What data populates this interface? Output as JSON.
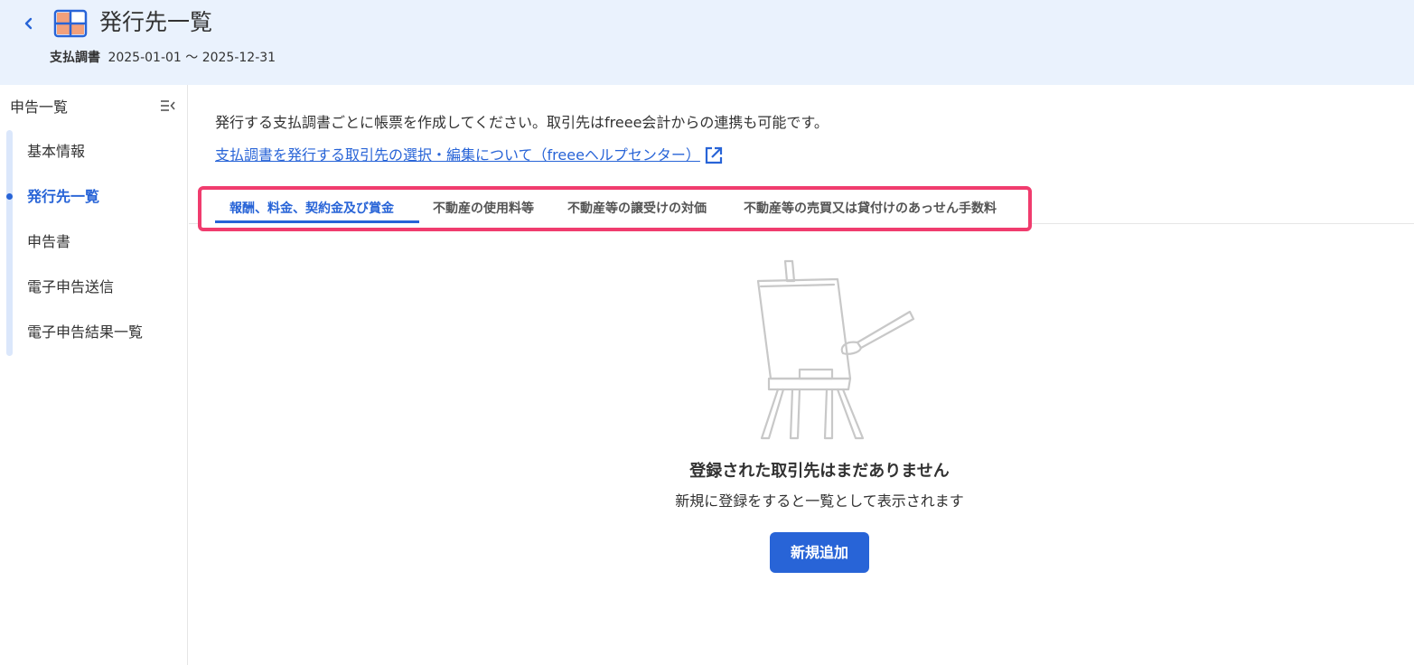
{
  "header": {
    "title": "発行先一覧",
    "doc_type": "支払調書",
    "period": "2025-01-01 〜 2025-12-31",
    "icon": "spreadsheet-icon",
    "back_icon": "chevron-left-icon"
  },
  "sidebar": {
    "heading": "申告一覧",
    "collapse_icon": "collapse-menu-icon",
    "items": [
      {
        "label": "基本情報",
        "active": false
      },
      {
        "label": "発行先一覧",
        "active": true
      },
      {
        "label": "申告書",
        "active": false
      },
      {
        "label": "電子申告送信",
        "active": false
      },
      {
        "label": "電子申告結果一覧",
        "active": false
      }
    ]
  },
  "main": {
    "description": "発行する支払調書ごとに帳票を作成してください。取引先はfreee会計からの連携も可能です。",
    "help_link": "支払調書を発行する取引先の選択・編集について（freeeヘルプセンター）",
    "tabs": [
      {
        "label": "報酬、料金、契約金及び賞金",
        "active": true
      },
      {
        "label": "不動産の使用料等",
        "active": false
      },
      {
        "label": "不動産等の譲受けの対価",
        "active": false
      },
      {
        "label": "不動産等の売買又は貸付けのあっせん手数料",
        "active": false
      }
    ],
    "empty_state": {
      "illustration": "easel-icon",
      "title": "登録された取引先はまだありません",
      "subtitle": "新規に登録をすると一覧として表示されます",
      "button_label": "新規追加"
    }
  },
  "colors": {
    "accent": "#2864d7",
    "header_bg": "#eaf2fd",
    "highlight": "#f03c6e",
    "icon_orange": "#f2a07b"
  }
}
